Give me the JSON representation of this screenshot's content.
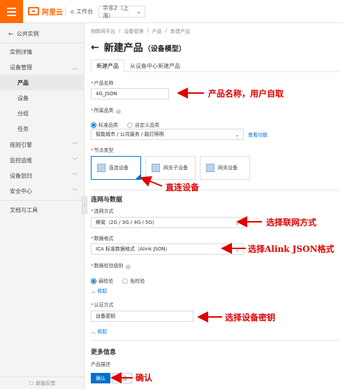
{
  "topbar": {
    "logo_text": "阿里云",
    "workbench": "工作台",
    "region": "华东2（上海）"
  },
  "sidebar": {
    "back_label": "公共实例",
    "items": [
      {
        "label": "实例详情"
      },
      {
        "label": "设备管理"
      },
      {
        "label": "产品"
      },
      {
        "label": "设备"
      },
      {
        "label": "分组"
      },
      {
        "label": "任务"
      },
      {
        "label": "规则引擎"
      },
      {
        "label": "监控运维"
      },
      {
        "label": "设备划归"
      },
      {
        "label": "安全中心"
      },
      {
        "label": "文档与工具"
      }
    ],
    "feedback": "新版反馈"
  },
  "breadcrumb": [
    "物联网平台",
    "设备管理",
    "产品",
    "新建产品"
  ],
  "page": {
    "title": "新建产品",
    "subtitle": "（设备模型）"
  },
  "tabs": [
    "新建产品",
    "从设备中心新建产品"
  ],
  "form": {
    "product_name_label": "产品名称",
    "product_name_value": "4G_JSON",
    "category_label": "所属品类",
    "category_standard": "标准品类",
    "category_custom": "自定义品类",
    "category_value": "智能城市 / 公共服务 / 路灯照明",
    "view_function": "查看功能",
    "node_type_label": "节点类型",
    "node_types": [
      "直连设备",
      "网关子设备",
      "网关设备"
    ],
    "section_network": "连网与数据",
    "network_label": "连网方式",
    "network_value": "蜂窝（2G / 3G / 4G / 5G）",
    "data_format_label": "数据格式",
    "data_format_value": "ICA 标准数据格式（Alink JSON）",
    "check_label": "数据校验级别",
    "check_weak": "弱校验",
    "check_none": "免校验",
    "collapse_1": "收起",
    "auth_label": "认证方式",
    "auth_value": "设备密钥",
    "collapse_2": "收起",
    "more_info": "更多信息",
    "product_desc": "产品描述",
    "confirm": "确认",
    "cancel": "取消"
  },
  "annotations": {
    "a1": "产品名称，用户自取",
    "a2": "直连设备",
    "a3": "选择联网方式",
    "a4": "选择Alink JSON格式",
    "a5": "选择设备密钥",
    "a6": "确认"
  },
  "colors": {
    "accent": "#0070cc",
    "brand": "#ff6a00",
    "annotation": "#e00000"
  }
}
